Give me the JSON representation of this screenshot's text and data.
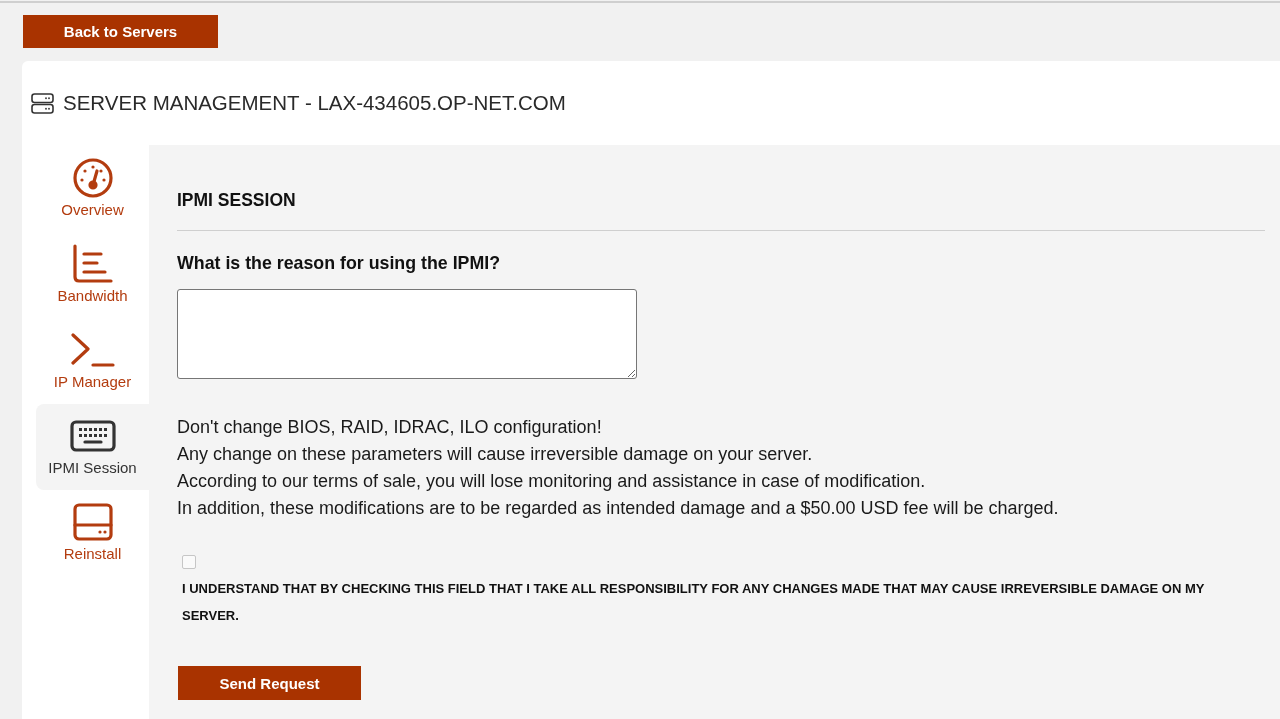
{
  "back_button": {
    "label": "Back to Servers"
  },
  "header": {
    "title": "SERVER MANAGEMENT - LAX-434605.OP-NET.COM"
  },
  "sidebar": {
    "items": [
      {
        "label": "Overview",
        "selected": false
      },
      {
        "label": "Bandwidth",
        "selected": false
      },
      {
        "label": "IP Manager",
        "selected": false
      },
      {
        "label": "IPMI Session",
        "selected": true
      },
      {
        "label": "Reinstall",
        "selected": false
      }
    ]
  },
  "panel": {
    "title": "IPMI SESSION",
    "question": "What is the reason for using the IPMI?",
    "warning_lines": [
      "Don't change BIOS, RAID, IDRAC, ILO configuration!",
      "Any change on these parameters will cause irreversible damage on your server.",
      "According to our terms of sale, you will lose monitoring and assistance in case of modification.",
      "In addition, these modifications are to be regarded as intended damage and a $50.00 USD fee will be charged."
    ],
    "consent": {
      "checked": false,
      "label": "I UNDERSTAND THAT BY CHECKING THIS FIELD THAT I TAKE ALL RESPONSIBILITY FOR ANY CHANGES MADE THAT MAY CAUSE IRREVERSIBLE DAMAGE ON MY SERVER."
    },
    "submit_button": {
      "label": "Send Request"
    }
  }
}
